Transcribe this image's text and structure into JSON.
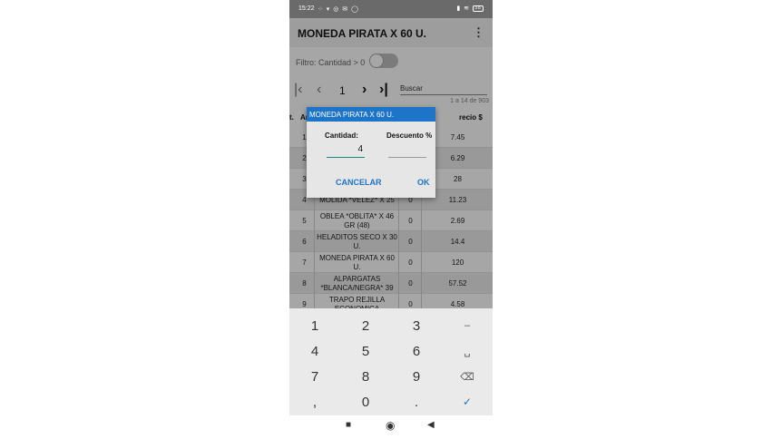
{
  "status_bar": {
    "time": "15:22",
    "notif_icons": "⁘ ▾ ◎ ✉ ◯",
    "battery": "38"
  },
  "app_bar": {
    "title": "MONEDA PIRATA X 60 U.",
    "menu_icon": "⋮"
  },
  "filter": {
    "label": "Filtro: Cantidad > 0",
    "enabled": false
  },
  "pager": {
    "first_icon": "|‹",
    "prev_icon": "‹",
    "page": "1",
    "next_icon": "›",
    "last_icon": "›|",
    "search_placeholder": "Buscar",
    "range": "1 a 14 de 903"
  },
  "table": {
    "headers": {
      "cant": "t.",
      "articulo": "Ar",
      "precio": "recio $"
    },
    "rows": [
      {
        "n": "1",
        "name": "",
        "qty": "",
        "price": "7.45"
      },
      {
        "n": "2",
        "name": "",
        "qty": "",
        "price": "6.29"
      },
      {
        "n": "3",
        "name": "",
        "qty": "",
        "price": "28"
      },
      {
        "n": "4",
        "name": "MOLIDA *VELEZ* X 25",
        "qty": "0",
        "price": "11.23"
      },
      {
        "n": "5",
        "name": "OBLEA *OBLITA* X 46 GR (48)",
        "qty": "0",
        "price": "2.69"
      },
      {
        "n": "6",
        "name": "HELADITOS SECO X 30 U.",
        "qty": "0",
        "price": "14.4"
      },
      {
        "n": "7",
        "name": "MONEDA PIRATA X 60 U.",
        "qty": "0",
        "price": "120"
      },
      {
        "n": "8",
        "name": "ALPARGATAS *BLANCA/NEGRA* 39",
        "qty": "0",
        "price": "57.52"
      },
      {
        "n": "9",
        "name": "TRAPO REJILLA ECONOMICA",
        "qty": "0",
        "price": "4.58"
      }
    ]
  },
  "dialog": {
    "title": "MONEDA PIRATA X 60 U.",
    "cantidad_label": "Cantidad:",
    "descuento_label": "Descuento %",
    "cantidad_value": "4",
    "descuento_value": "",
    "cancel_label": "CANCELAR",
    "ok_label": "OK"
  },
  "keyboard": {
    "keys": [
      [
        "1",
        "2",
        "3",
        "–"
      ],
      [
        "4",
        "5",
        "6",
        "␣"
      ],
      [
        "7",
        "8",
        "9",
        "⌫"
      ],
      [
        ",",
        "0",
        ".",
        "✓"
      ]
    ]
  },
  "nav": {
    "recents": "■",
    "home": "◉",
    "back": "◀"
  },
  "colors": {
    "accent": "#1e74c6",
    "status_bar": "#6a6a6a",
    "input_underline": "#1a8a7a"
  }
}
